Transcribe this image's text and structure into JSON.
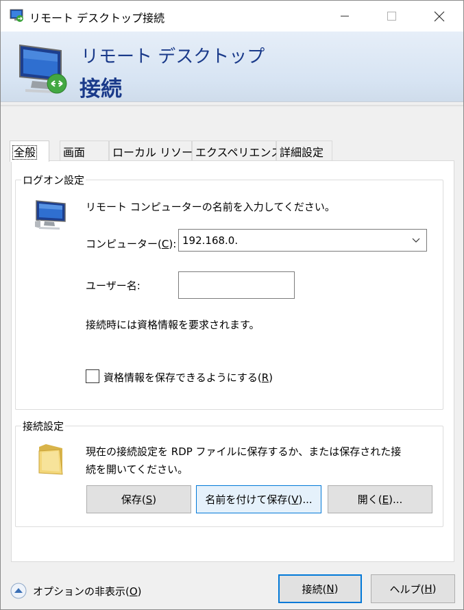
{
  "window": {
    "title": "リモート デスクトップ接続",
    "banner_line1": "リモート デスクトップ",
    "banner_line2": "接続"
  },
  "tabs": [
    {
      "label": "全般",
      "active": true
    },
    {
      "label": "画面",
      "active": false
    },
    {
      "label": "ローカル リソース",
      "active": false
    },
    {
      "label": "エクスペリエンス",
      "active": false
    },
    {
      "label": "詳細設定",
      "active": false
    }
  ],
  "logon": {
    "group_title": "ログオン設定",
    "instruction": "リモート コンピューターの名前を入力してください。",
    "computer_label_pre": "コンピューター(",
    "computer_label_key": "C",
    "computer_label_post": "):",
    "computer_value": "192.168.0.",
    "username_label": "ユーザー名:",
    "username_value": "",
    "credential_note": "接続時には資格情報を要求されます。",
    "save_checkbox_pre": "資格情報を保存できるようにする(",
    "save_checkbox_key": "R",
    "save_checkbox_post": ")",
    "save_checked": false
  },
  "connection": {
    "group_title": "接続設定",
    "description_line1": "現在の接続設定を RDP ファイルに保存するか、または保存された接",
    "description_line2": "続を開いてください。",
    "save_pre": "保存(",
    "save_key": "S",
    "save_post": ")",
    "save_as_pre": "名前を付けて保存(",
    "save_as_key": "V",
    "save_as_post": ")...",
    "open_pre": "開く(",
    "open_key": "E",
    "open_post": ")..."
  },
  "footer": {
    "options_pre": "オプションの非表示(",
    "options_key": "O",
    "options_post": ")",
    "connect_pre": "接続(",
    "connect_key": "N",
    "connect_post": ")",
    "help_pre": "ヘルプ(",
    "help_key": "H",
    "help_post": ")"
  },
  "colors": {
    "banner_text": "#1a3a8a",
    "accent": "#0078d7"
  }
}
